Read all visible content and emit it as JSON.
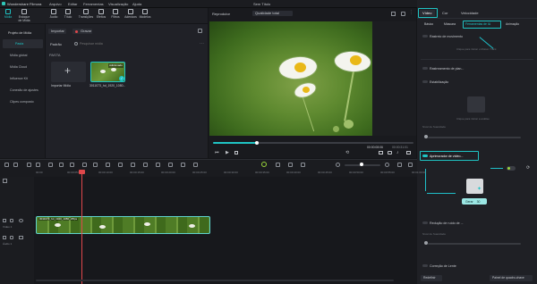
{
  "titlebar": {
    "app_name": "Wondershare Filmora",
    "menus": [
      "Arquivo",
      "Editar",
      "Ferramentas",
      "Visualização",
      "Ajuda"
    ],
    "project_title": "Sem Título",
    "buy_label": "Comprar",
    "export_label": "Exportar"
  },
  "toolbar": {
    "tools": [
      {
        "label": "Mídia",
        "icon": "media-icon"
      },
      {
        "label": "Estoque de Mídia",
        "icon": "stock-icon"
      },
      {
        "label": "Áudio",
        "icon": "audio-icon"
      },
      {
        "label": "Título",
        "icon": "title-icon"
      },
      {
        "label": "Transições",
        "icon": "transitions-icon"
      },
      {
        "label": "Efeitos",
        "icon": "effects-icon"
      },
      {
        "label": "Filtros",
        "icon": "filters-icon"
      },
      {
        "label": "Adesivos",
        "icon": "stickers-icon"
      },
      {
        "label": "Modelos",
        "icon": "templates-icon"
      }
    ]
  },
  "sidebar": {
    "header": "Projeto de Mídia",
    "items": [
      "Pasta",
      "Mídia global",
      "Mídia Cloud",
      "Influence Kit",
      "Conexão de ajustes",
      "Clipes composto"
    ]
  },
  "media": {
    "import_label": "Importar",
    "record_label": "Gravar",
    "sort_label": "Padrão",
    "search_placeholder": "Pesquisar mídia",
    "folder_label": "PASTA",
    "import_tile_label": "Importar Mídia",
    "clip_label": "3011073_hd_1920_1080...",
    "clip_badge": "Adicionado"
  },
  "player": {
    "label": "Reprodutor",
    "quality": "Qualidade total",
    "current_time": "00:00:08:06",
    "total_time": "00:00:31:01",
    "progress": 0.22
  },
  "right_panel": {
    "tabs": [
      "Vídeo",
      "Cor",
      "Velocidade"
    ],
    "subtabs": [
      "Básico",
      "Máscara",
      "Ferramentas de IA",
      "Animação"
    ],
    "sections": [
      "Rastreio de movimento",
      "Rastreamento de plan...",
      "Estabilização",
      "Aprimorador de vídeo...",
      "Redução de ruído de ...",
      "Correção de Lente"
    ],
    "hint_text": "Clique para iniciar o Motion Track",
    "stabilize_hint": "Clique para iniciar a análise",
    "strength_label": "Nível de Suavidade",
    "noise_label": "Nível de Suavidade",
    "generate_label": "Gerar",
    "generate_cost": "30",
    "reset_label": "Redefinir",
    "keyframe_label": "Painel de quadro-chave"
  },
  "timeline": {
    "ruler": [
      "00:00",
      "00:00:05:00",
      "00:00:10:00",
      "00:00:15:00",
      "00:00:20:00",
      "00:00:25:00",
      "00:00:30:00",
      "00:00:35:00",
      "00:00:40:00",
      "00:00:45:00",
      "00:00:50:00",
      "00:00:55:00",
      "00:01:00:00"
    ],
    "video_track_label": "Vídeo 1",
    "audio_track_label": "Áudio 1",
    "clip_name": "3011073_hd_1920_1080_25fps"
  },
  "colors": {
    "accent": "#1fc4c4",
    "export": "#2d6ee8",
    "buy": "#e33a3a",
    "playhead": "#e0484b"
  }
}
